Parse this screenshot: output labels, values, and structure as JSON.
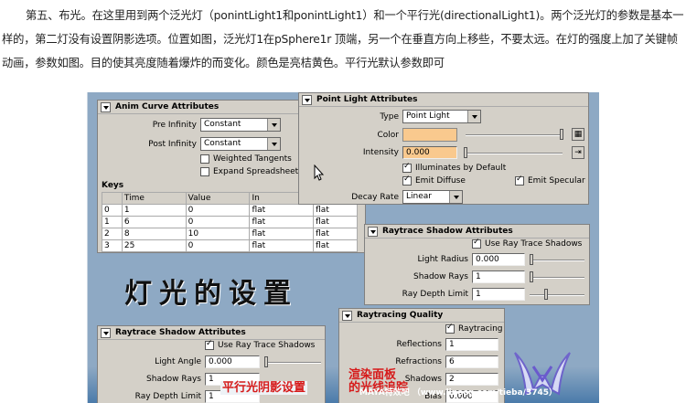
{
  "intro_text": "第五、布光。在这里用到两个泛光灯（ponintLight1和ponintLight1）和一个平行光(directionalLight1)。两个泛光灯的参数是基本一样的，第二灯没有设置阴影选项。位置如图，泛光灯1在pSphere1r 顶端，另一个在垂直方向上移些，不要太远。在灯的强度上加了关键帧动画，参数如图。目的使其亮度随着爆炸的而变化。颜色是亮桔黄色。平行光默认参数即可",
  "anim_curve": {
    "title": "Anim Curve Attributes",
    "pre_infinity_label": "Pre Infinity",
    "pre_infinity_value": "Constant",
    "post_infinity_label": "Post Infinity",
    "post_infinity_value": "Constant",
    "weighted_tangents": "Weighted Tangents",
    "expand_spreadsheet": "Expand Spreadsheet",
    "keys_label": "Keys",
    "columns": [
      "",
      "Time",
      "Value",
      "In",
      ""
    ],
    "rows": [
      [
        "0",
        "1",
        "0",
        "flat",
        "flat"
      ],
      [
        "1",
        "6",
        "0",
        "flat",
        "flat"
      ],
      [
        "2",
        "8",
        "10",
        "flat",
        "flat"
      ],
      [
        "3",
        "25",
        "0",
        "flat",
        "flat"
      ]
    ]
  },
  "point_light": {
    "title": "Point Light Attributes",
    "type_label": "Type",
    "type_value": "Point Light",
    "color_label": "Color",
    "color_swatch": "#f9c98e",
    "intensity_label": "Intensity",
    "intensity_value": "0.000",
    "intensity_field_color": "#f9c98e",
    "illuminates_default": "Illuminates by Default",
    "emit_diffuse": "Emit Diffuse",
    "emit_specular": "Emit Specular",
    "decay_label": "Decay Rate",
    "decay_value": "Linear"
  },
  "raytrace_shadow_top": {
    "title": "Raytrace Shadow Attributes",
    "use_ray_trace": "Use Ray Trace Shadows",
    "light_radius_label": "Light Radius",
    "light_radius_value": "0.000",
    "shadow_rays_label": "Shadow Rays",
    "shadow_rays_value": "1",
    "ray_depth_label": "Ray Depth Limit",
    "ray_depth_value": "1"
  },
  "raytrace_shadow_bottom": {
    "title": "Raytrace Shadow Attributes",
    "use_ray_trace": "Use Ray Trace Shadows",
    "light_angle_label": "Light Angle",
    "light_angle_value": "0.000",
    "shadow_rays_label": "Shadow Rays",
    "shadow_rays_value": "1",
    "ray_depth_label": "Ray Depth Limit",
    "ray_depth_value": "1"
  },
  "raytracing_quality": {
    "title": "Raytracing Quality",
    "raytracing": "Raytracing",
    "reflections_label": "Reflections",
    "reflections_value": "1",
    "refractions_label": "Refractions",
    "refractions_value": "6",
    "shadows_label": "Shadows",
    "shadows_value": "2",
    "bias_label": "Bias",
    "bias_value": "0.000"
  },
  "big_title": "灯光的设置",
  "caption_directional": "平行光阴影设置",
  "caption_render_line1": "渲染面板",
  "caption_render_line2": "的光线追踪",
  "watermark": "MAYA特效吧 （www.linecg.com/tieba/3745）"
}
